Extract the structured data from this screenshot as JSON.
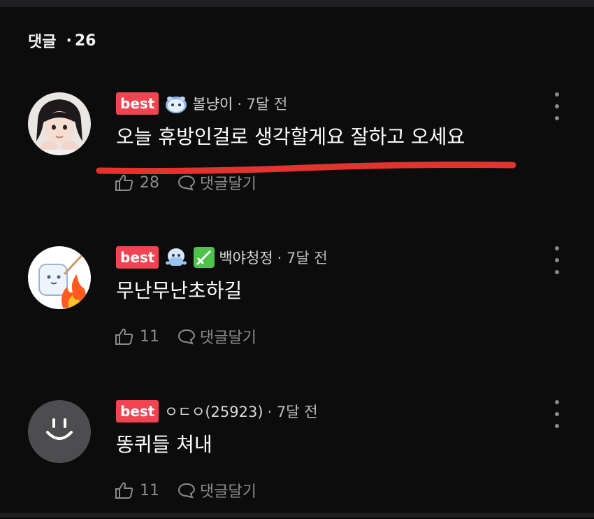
{
  "header": {
    "title": "댓글",
    "separator": "·",
    "count": "26"
  },
  "colors": {
    "background": "#0c0c0d",
    "best_badge": "#f04452",
    "annotation_underline": "#e3332e",
    "muted_text": "#8c8c8c"
  },
  "comments": [
    {
      "badge": "best",
      "badge_icons": [
        "cloud-mascot-icon"
      ],
      "username": "볼냥이",
      "time": "· 7달 전",
      "text": "오늘 휴방인걸로 생각할게요 잘하고 오세요",
      "likes": "28",
      "reply_label": "댓글달기",
      "avatar": "photo-avatar"
    },
    {
      "badge": "best",
      "badge_icons": [
        "ghost-mascot-icon",
        "sword-icon"
      ],
      "username": "백야청정",
      "time": "· 7달 전",
      "text": "무난무난초하길",
      "likes": "11",
      "reply_label": "댓글달기",
      "avatar": "marshmallow-fire-avatar"
    },
    {
      "badge": "best",
      "badge_icons": [],
      "username": "ㅇㄷㅇ(25923)",
      "time": "· 7달 전",
      "text": "똥퀴들 쳐내",
      "likes": "11",
      "reply_label": "댓글달기",
      "avatar": "smiley-default-avatar"
    }
  ]
}
